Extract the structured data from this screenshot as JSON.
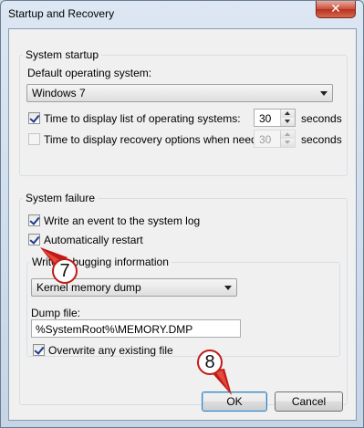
{
  "window": {
    "title": "Startup and Recovery",
    "close_glyph": "✕"
  },
  "system_startup": {
    "group_label": "System startup",
    "default_os_label": "Default operating system:",
    "default_os_value": "Windows 7",
    "time_list_label": "Time to display list of operating systems:",
    "time_list_checked": true,
    "time_list_value": "30",
    "time_list_unit": "seconds",
    "time_recovery_label": "Time to display recovery options when needed:",
    "time_recovery_checked": false,
    "time_recovery_value": "30",
    "time_recovery_unit": "seconds"
  },
  "system_failure": {
    "group_label": "System failure",
    "write_event_label": "Write an event to the system log",
    "write_event_checked": true,
    "auto_restart_label": "Automatically restart",
    "auto_restart_checked": true,
    "debug_group_label": "Write debugging information",
    "debug_type_value": "Kernel memory dump",
    "dump_file_label": "Dump file:",
    "dump_file_value": "%SystemRoot%\\MEMORY.DMP",
    "overwrite_label": "Overwrite any existing file",
    "overwrite_checked": true
  },
  "buttons": {
    "ok": "OK",
    "cancel": "Cancel"
  },
  "annotations": {
    "step7": "7",
    "step8": "8",
    "marker_color": "#c11b17"
  },
  "colors": {
    "window_frame": "#cfd9e6",
    "dialog_bg": "#f0f0f0",
    "close_button": "#c9503c"
  }
}
